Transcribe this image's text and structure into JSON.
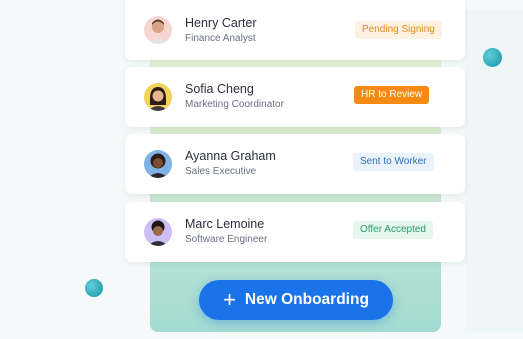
{
  "employees": [
    {
      "name": "Henry Carter",
      "role": "Finance Analyst",
      "status": "Pending Signing",
      "avatar_icon": "avatar-henry"
    },
    {
      "name": "Sofia Cheng",
      "role": "Marketing Coordinator",
      "status": "HR to Review",
      "avatar_icon": "avatar-sofia"
    },
    {
      "name": "Ayanna Graham",
      "role": "Sales Executive",
      "status": "Sent to Worker",
      "avatar_icon": "avatar-ayanna"
    },
    {
      "name": "Marc Lemoine",
      "role": "Software Engineer",
      "status": "Offer Accepted",
      "avatar_icon": "avatar-marc"
    }
  ],
  "cta": {
    "label": "New Onboarding",
    "icon": "plus-icon"
  },
  "colors": {
    "accent": "#1a73e8",
    "pending": "#e08a1b",
    "review": "#f48a12",
    "sent": "#2f6fb8",
    "accepted": "#2a9c6c"
  }
}
